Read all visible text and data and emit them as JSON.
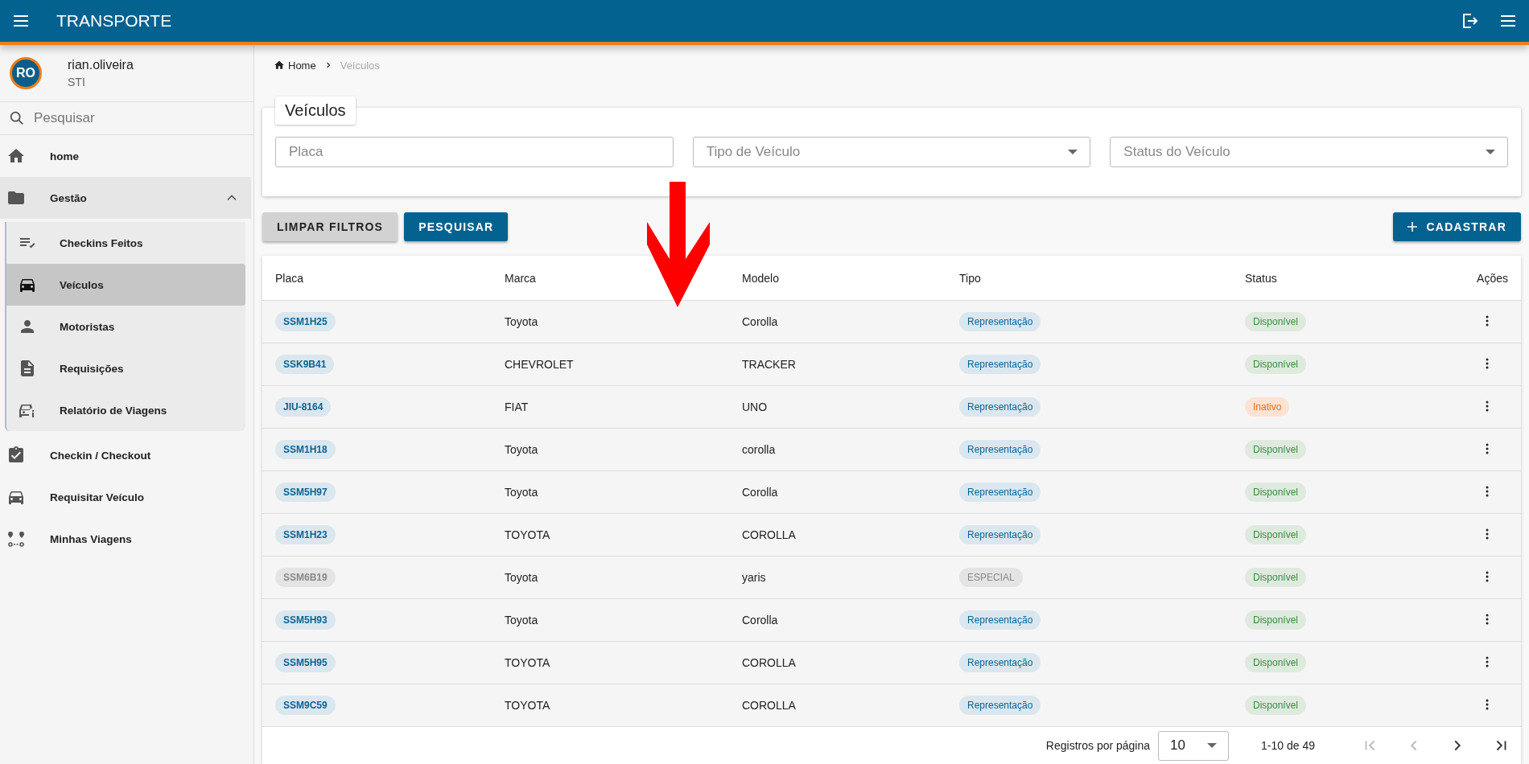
{
  "app_bar": {
    "title": "TRANSPORTE"
  },
  "user": {
    "initials": "RO",
    "name": "rian.oliveira",
    "department": "STI"
  },
  "sidebar": {
    "search": {
      "placeholder": "Pesquisar"
    },
    "items": [
      {
        "label": "home",
        "kind": "home",
        "selected": false
      },
      {
        "label": "Gestão",
        "kind": "folder",
        "selected": false,
        "expanded": true,
        "children": [
          {
            "label": "Checkins Feitos",
            "kind": "checklist",
            "selected": false
          },
          {
            "label": "Veículos",
            "kind": "car",
            "selected": true
          },
          {
            "label": "Motoristas",
            "kind": "person",
            "selected": false
          },
          {
            "label": "Requisições",
            "kind": "document",
            "selected": false
          },
          {
            "label": "Relatório de Viagens",
            "kind": "car-report",
            "selected": false
          }
        ]
      },
      {
        "label": "Checkin / Checkout",
        "kind": "clipboard",
        "selected": false
      },
      {
        "label": "Requisitar Veículo",
        "kind": "car",
        "selected": false
      },
      {
        "label": "Minhas Viagens",
        "kind": "route",
        "selected": false
      }
    ]
  },
  "breadcrumb": [
    {
      "label": "Home"
    },
    {
      "label": "Veículos"
    }
  ],
  "filters": {
    "title": "Veículos",
    "fields": [
      {
        "placeholder": "Placa",
        "kind": "text"
      },
      {
        "placeholder": "Tipo de Veículo",
        "kind": "select"
      },
      {
        "placeholder": "Status do Veículo",
        "kind": "select"
      }
    ]
  },
  "buttons": {
    "clear": "LIMPAR FILTROS",
    "search": "PESQUISAR",
    "create": "CADASTRAR"
  },
  "annotation": {
    "kind": "arrow-down"
  },
  "table": {
    "columns": [
      "Placa",
      "Marca",
      "Modelo",
      "Tipo",
      "Status",
      "Ações"
    ],
    "rows": [
      {
        "placa": "SSM1H25",
        "marca": "Toyota",
        "modelo": "Corolla",
        "tipo": {
          "label": "Representação",
          "kind": "representacao"
        },
        "status": {
          "label": "Disponível",
          "kind": "disponivel"
        }
      },
      {
        "placa": "SSK9B41",
        "marca": "CHEVROLET",
        "modelo": "TRACKER",
        "tipo": {
          "label": "Representação",
          "kind": "representacao"
        },
        "status": {
          "label": "Disponível",
          "kind": "disponivel"
        }
      },
      {
        "placa": "JIU-8164",
        "marca": "FIAT",
        "modelo": "UNO",
        "tipo": {
          "label": "Representação",
          "kind": "representacao"
        },
        "status": {
          "label": "Inativo",
          "kind": "inativo"
        }
      },
      {
        "placa": "SSM1H18",
        "marca": "Toyota",
        "modelo": "corolla",
        "tipo": {
          "label": "Representação",
          "kind": "representacao"
        },
        "status": {
          "label": "Disponível",
          "kind": "disponivel"
        }
      },
      {
        "placa": "SSM5H97",
        "marca": "Toyota",
        "modelo": "Corolla",
        "tipo": {
          "label": "Representação",
          "kind": "representacao"
        },
        "status": {
          "label": "Disponível",
          "kind": "disponivel"
        }
      },
      {
        "placa": "SSM1H23",
        "marca": "TOYOTA",
        "modelo": "COROLLA",
        "tipo": {
          "label": "Representação",
          "kind": "representacao"
        },
        "status": {
          "label": "Disponível",
          "kind": "disponivel"
        }
      },
      {
        "placa": "SSM6B19",
        "marca": "Toyota",
        "modelo": "yaris",
        "tipo": {
          "label": "ESPECIAL",
          "kind": "especial"
        },
        "status": {
          "label": "Disponível",
          "kind": "disponivel"
        }
      },
      {
        "placa": "SSM5H93",
        "marca": "Toyota",
        "modelo": "Corolla",
        "tipo": {
          "label": "Representação",
          "kind": "representacao"
        },
        "status": {
          "label": "Disponível",
          "kind": "disponivel"
        }
      },
      {
        "placa": "SSM5H95",
        "marca": "TOYOTA",
        "modelo": "COROLLA",
        "tipo": {
          "label": "Representação",
          "kind": "representacao"
        },
        "status": {
          "label": "Disponível",
          "kind": "disponivel"
        }
      },
      {
        "placa": "SSM9C59",
        "marca": "TOYOTA",
        "modelo": "COROLLA",
        "tipo": {
          "label": "Representação",
          "kind": "representacao"
        },
        "status": {
          "label": "Disponível",
          "kind": "disponivel"
        }
      }
    ]
  },
  "pagination": {
    "label": "Registros por página",
    "page_size": "10",
    "range": "1-10 de 49"
  }
}
